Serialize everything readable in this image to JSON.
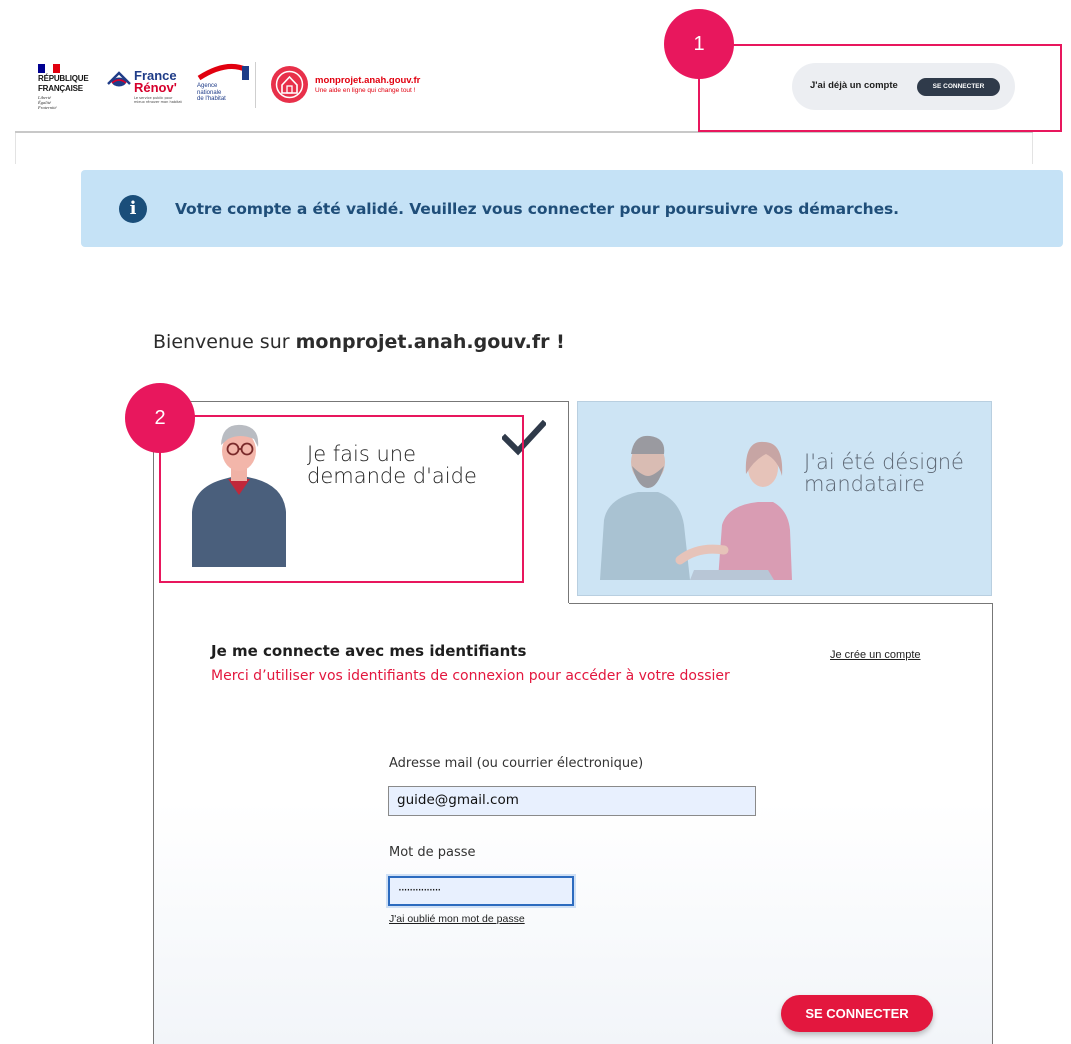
{
  "header": {
    "rf_logo": {
      "line1": "RÉPUBLIQUE",
      "line2": "FRANÇAISE",
      "motto": [
        "Liberté",
        "Égalité",
        "Fraternité"
      ]
    },
    "france_renov": {
      "line1": "France",
      "line2": "Rénov'",
      "tagline": "Le service public pour mieux rénover mon habitat"
    },
    "anah": {
      "line1": "Agence",
      "line2": "nationale",
      "line3": "de l'habitat"
    },
    "monprojet": {
      "title": "monprojet.anah.gouv.fr",
      "subtitle": "Une aide en ligne qui change tout !"
    },
    "account_prompt": "J'ai déjà un compte",
    "account_button": "SE CONNECTER"
  },
  "annotations": {
    "first": "1",
    "second": "2"
  },
  "banner": {
    "icon": "info-icon",
    "text": "Votre compte a été validé. Veuillez vous connecter pour poursuivre vos démarches."
  },
  "welcome": {
    "prefix": "Bienvenue sur ",
    "site": "monprojet.anah.gouv.fr !"
  },
  "tabs": [
    {
      "label": "Je fais une demande d'aide",
      "selected": true,
      "icon": "checkmark-icon"
    },
    {
      "label": "J'ai été désigné mandataire",
      "selected": false
    }
  ],
  "login": {
    "title": "Je me connecte avec mes identifiants",
    "subtitle": "Merci d’utiliser vos identifiants de connexion pour accéder à votre dossier",
    "create_account": "Je crée un compte",
    "email_label": "Adresse mail (ou courrier électronique)",
    "email_value": "guide@gmail.com",
    "password_label": "Mot de passe",
    "password_value": "···············",
    "forgot_password": "J'ai oublié mon mot de passe",
    "submit": "SE CONNECTER"
  },
  "colors": {
    "accent": "#e3173e",
    "annotation": "#e8175d",
    "banner_bg": "#c5e2f6",
    "banner_text": "#1f4e79",
    "account_button_bg": "#2f3a4a",
    "inactive_tab_bg": "#cde4f4"
  }
}
